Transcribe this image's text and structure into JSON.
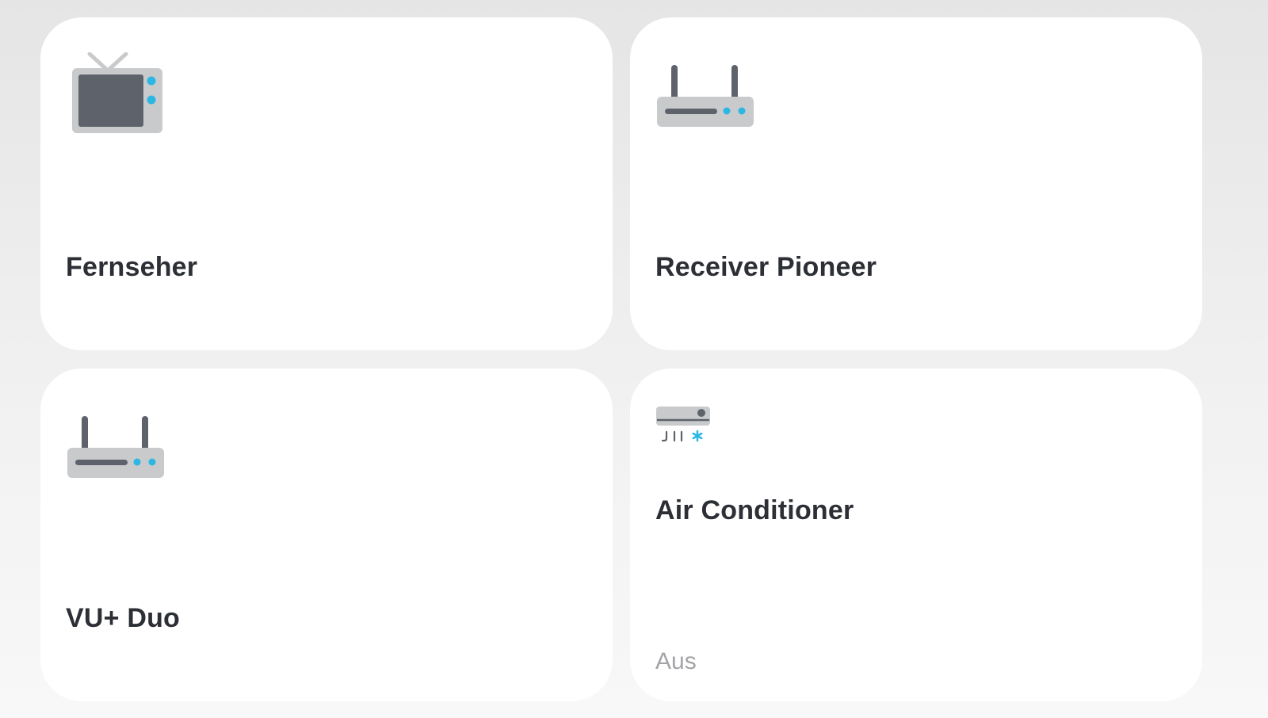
{
  "colors": {
    "card_background": "#ffffff",
    "text_primary": "#2d2f36",
    "text_secondary": "#a2a4a8",
    "icon_dark": "#5e636b",
    "icon_light": "#c9cacc",
    "icon_accent": "#2bb7e4"
  },
  "devices": [
    {
      "name": "Fernseher",
      "icon": "tv-icon"
    },
    {
      "name": "Receiver Pioneer",
      "icon": "router-icon"
    },
    {
      "name": "VU+ Duo",
      "icon": "router-icon"
    },
    {
      "name": "Air Conditioner",
      "icon": "air-conditioner-icon",
      "status": "Aus"
    }
  ]
}
